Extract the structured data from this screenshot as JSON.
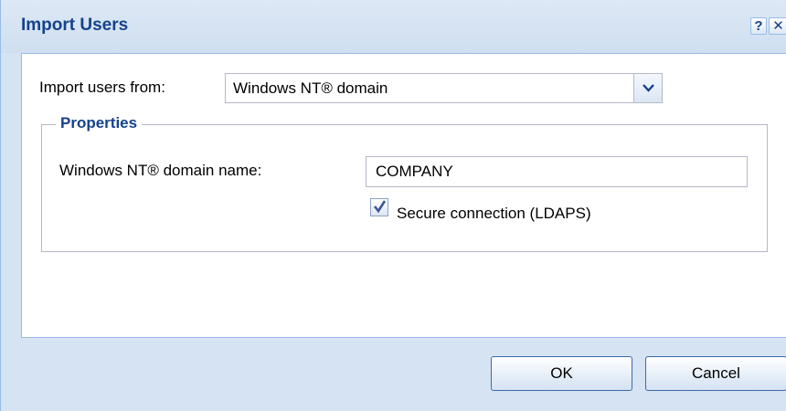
{
  "dialog": {
    "title": "Import Users",
    "help_label": "?",
    "close_label": "✕"
  },
  "form": {
    "import_from_label": "Import users from:",
    "import_from_value": "Windows NT® domain",
    "properties_legend": "Properties",
    "domain_name_label": "Windows NT® domain name:",
    "domain_name_value": "COMPANY",
    "secure_connection_label": "Secure connection (LDAPS)",
    "secure_connection_checked": true
  },
  "buttons": {
    "ok_label": "OK",
    "cancel_label": "Cancel"
  },
  "colors": {
    "title_text": "#15428b",
    "window_background": "#d6e3f2",
    "border": "#99bbe8"
  }
}
